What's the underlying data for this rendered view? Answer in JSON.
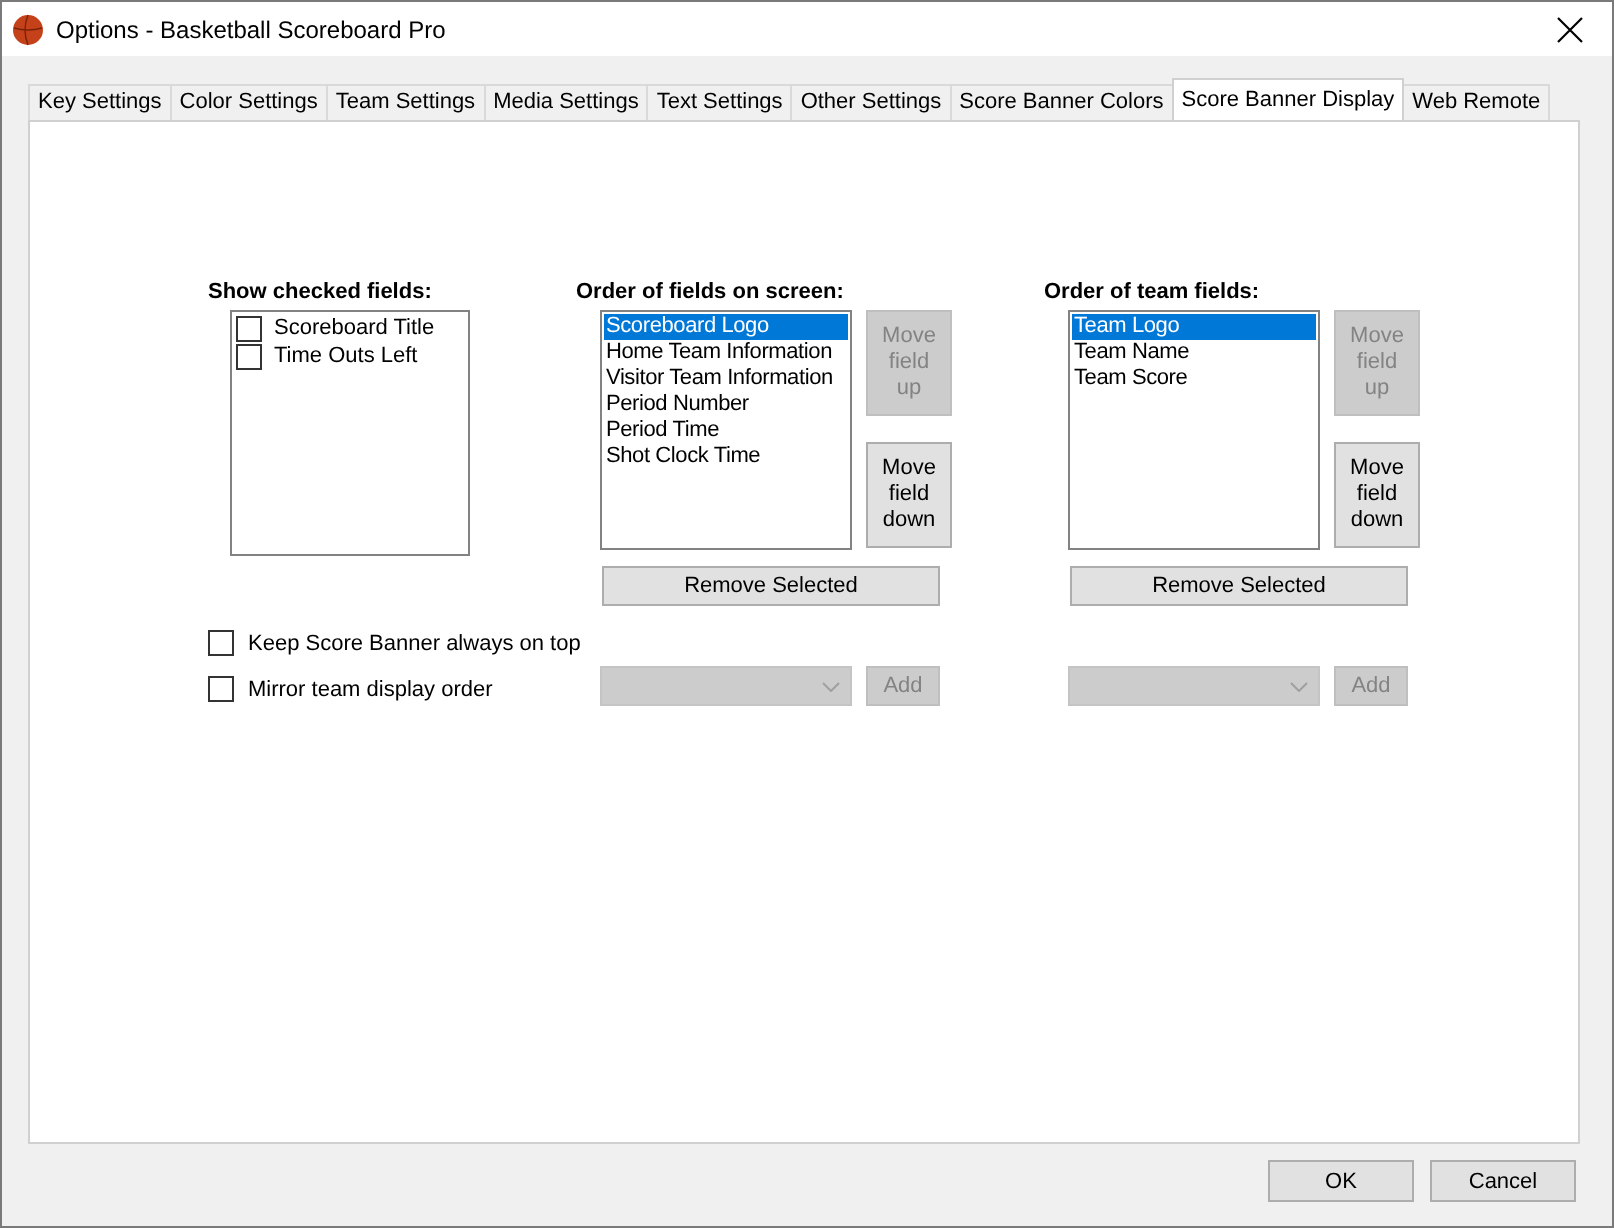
{
  "window": {
    "title": "Options - Basketball Scoreboard Pro"
  },
  "tabs": [
    {
      "label": "Key Settings",
      "selected": false
    },
    {
      "label": "Color Settings",
      "selected": false
    },
    {
      "label": "Team Settings",
      "selected": false
    },
    {
      "label": "Media Settings",
      "selected": false
    },
    {
      "label": "Text Settings",
      "selected": false
    },
    {
      "label": "Other Settings",
      "selected": false
    },
    {
      "label": "Score Banner Colors",
      "selected": false
    },
    {
      "label": "Score Banner Display",
      "selected": true
    },
    {
      "label": "Web Remote",
      "selected": false
    }
  ],
  "show_fields": {
    "label": "Show checked fields:",
    "items": [
      {
        "label": "Scoreboard Title",
        "checked": false
      },
      {
        "label": "Time Outs Left",
        "checked": false
      }
    ]
  },
  "options": [
    {
      "label": "Keep Score Banner always on top",
      "checked": false
    },
    {
      "label": "Mirror team display order",
      "checked": false
    }
  ],
  "lists": [
    {
      "label": "Order of fields on screen:",
      "items": [
        {
          "label": "Scoreboard Logo",
          "selected": true
        },
        {
          "label": "Home Team Information",
          "selected": false
        },
        {
          "label": "Visitor Team Information",
          "selected": false
        },
        {
          "label": "Period Number",
          "selected": false
        },
        {
          "label": "Period Time",
          "selected": false
        },
        {
          "label": "Shot Clock Time",
          "selected": false
        }
      ],
      "move_up": {
        "label": "Move field up",
        "disabled": true
      },
      "move_down": {
        "label": "Move field down",
        "disabled": false
      },
      "remove": "Remove Selected",
      "combo_disabled": true,
      "add": {
        "label": "Add",
        "disabled": true
      }
    },
    {
      "label": "Order of team fields:",
      "items": [
        {
          "label": "Team Logo",
          "selected": true
        },
        {
          "label": "Team Name",
          "selected": false
        },
        {
          "label": "Team Score",
          "selected": false
        }
      ],
      "move_up": {
        "label": "Move field up",
        "disabled": true
      },
      "move_down": {
        "label": "Move field down",
        "disabled": false
      },
      "remove": "Remove Selected",
      "combo_disabled": true,
      "add": {
        "label": "Add",
        "disabled": true
      }
    }
  ],
  "buttons": [
    "OK",
    "Cancel"
  ]
}
